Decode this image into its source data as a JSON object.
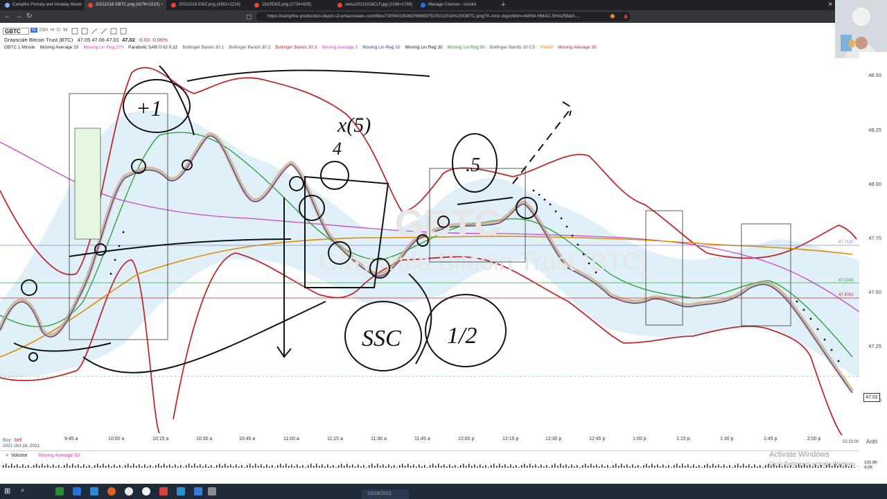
{
  "browser": {
    "tabs": [
      {
        "title": "Campfire Primary and Intraday Maste"
      },
      {
        "title": "20211018 GBTC.png (4276×2210)"
      },
      {
        "title": "20211018 EWZ.png (4382×2214)"
      },
      {
        "title": "1810EWZ.png (1734×829)"
      },
      {
        "title": "swiss20211018CLF.jpg (2186×1789)"
      },
      {
        "title": "Manage Courses - rozoko"
      }
    ],
    "url": "https://campfire-production-depot.s3.amazonaws.com/files/73004/135482/9665975/20211018%20GBTC.png?X-Amz-Algorithm=AWS4-HMAC-SHA256&X-...",
    "new_tab": "+",
    "close": "×"
  },
  "toolbar": {
    "symbol": "GBTC",
    "timeframes": [
      "m",
      "15m",
      "H",
      "D",
      "W"
    ]
  },
  "quote": {
    "name": "Grayscale Bitcoin Trust (BTC)",
    "values": "47.05  47.06  47.01",
    "last": "47.02",
    "change": "-0.03  -0.06%"
  },
  "studies": [
    {
      "label": "GBTC 1 Minute",
      "color": "#222222"
    },
    {
      "label": "Moving Average 10",
      "color": "#222222"
    },
    {
      "label": "Moving Lin Reg 270",
      "color": "#cc44cc"
    },
    {
      "label": "Parabolic SAR 0.02 0.12",
      "color": "#222222"
    },
    {
      "label": "Bollinger Bands 30 1",
      "color": "#555555"
    },
    {
      "label": "Bollinger Bands 30 2",
      "color": "#555555"
    },
    {
      "label": "Bollinger Bands 30 3",
      "color": "#c0282d"
    },
    {
      "label": "Moving Average 3",
      "color": "#cc44cc"
    },
    {
      "label": "Moving Lin Reg 10",
      "color": "#3a3aa8"
    },
    {
      "label": "Moving Lin Reg 30",
      "color": "#222222"
    },
    {
      "label": "Moving Lin Reg 90",
      "color": "#1f9e2e"
    },
    {
      "label": "Bollinger Bands 10 0.5",
      "color": "#555555"
    },
    {
      "label": "VWAP",
      "color": "#e08a00"
    },
    {
      "label": "Moving Average 30",
      "color": "#c0282d"
    }
  ],
  "watermark": {
    "symbol": "GBTC",
    "name": "Grayscale Bitcoin Trust (BTC)"
  },
  "axis": {
    "y_ticks": [
      "48.50",
      "48.25",
      "48.00",
      "47.75",
      "47.50",
      "47.25",
      "47.00"
    ],
    "x_ticks": [
      "9:45 a",
      "10:00 a",
      "10:15 a",
      "10:30 a",
      "10:45 a",
      "11:00 a",
      "11:15 a",
      "11:30 a",
      "11:45 a",
      "12:00 p",
      "12:15 p",
      "12:30 p",
      "12:45 p",
      "1:00 p",
      "1:15 p",
      "1:30 p",
      "1:45 p",
      "2:00 p"
    ],
    "right_tags": [
      "47.7130",
      "47.5343",
      "47.4762"
    ],
    "last_price_tag": "47.02",
    "time_tag": "02:13:00",
    "scale_mode": "Arith"
  },
  "buy_label": "Buy",
  "sell_label": "Sell",
  "date_label": "2021 Oct 18, 2021",
  "volume": {
    "label": "Volume",
    "study": "Moving Average 50",
    "scale": "100.0K",
    "scale2": "4.0K"
  },
  "annotations": {
    "circle_1": "+1",
    "circle_5": "x(5)",
    "four": "4",
    "point5": ".5",
    "ssc": "SSC",
    "one_two": "1/2"
  },
  "activate": {
    "title": "Activate Windows",
    "sub": "Go to Settings to activate Windows."
  },
  "taskbar": {
    "date": "10/18/2021"
  }
}
